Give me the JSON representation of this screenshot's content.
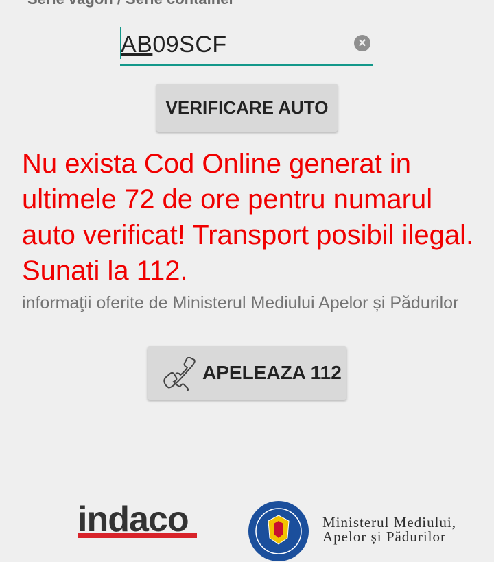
{
  "form": {
    "field_label": "Serie vagon / Serie container",
    "input_value_underlined": "AB",
    "input_value_rest": "09SCF",
    "clear_icon": "×"
  },
  "buttons": {
    "verify_label": "VERIFICARE AUTO",
    "call_label": "APELEAZA 112"
  },
  "result": {
    "message": "Nu exista Cod Online generat in ultimele 72 de ore pentru numarul auto verificat! Transport posibil ilegal. Sunati la 112.",
    "source_info": "informaţii oferite de Ministerul Mediului Apelor și Pădurilor"
  },
  "footer": {
    "indaco_logo": "indaco",
    "ministry_line1": "Ministerul Mediului,",
    "ministry_line2": "Apelor și Pădurilor"
  },
  "icons": {
    "clear": "clear-icon",
    "phone": "phone-icon"
  },
  "colors": {
    "accent": "#13988a",
    "alert": "#f00000",
    "brand_red": "#d8232a",
    "seal_blue": "#1b4f9c"
  }
}
